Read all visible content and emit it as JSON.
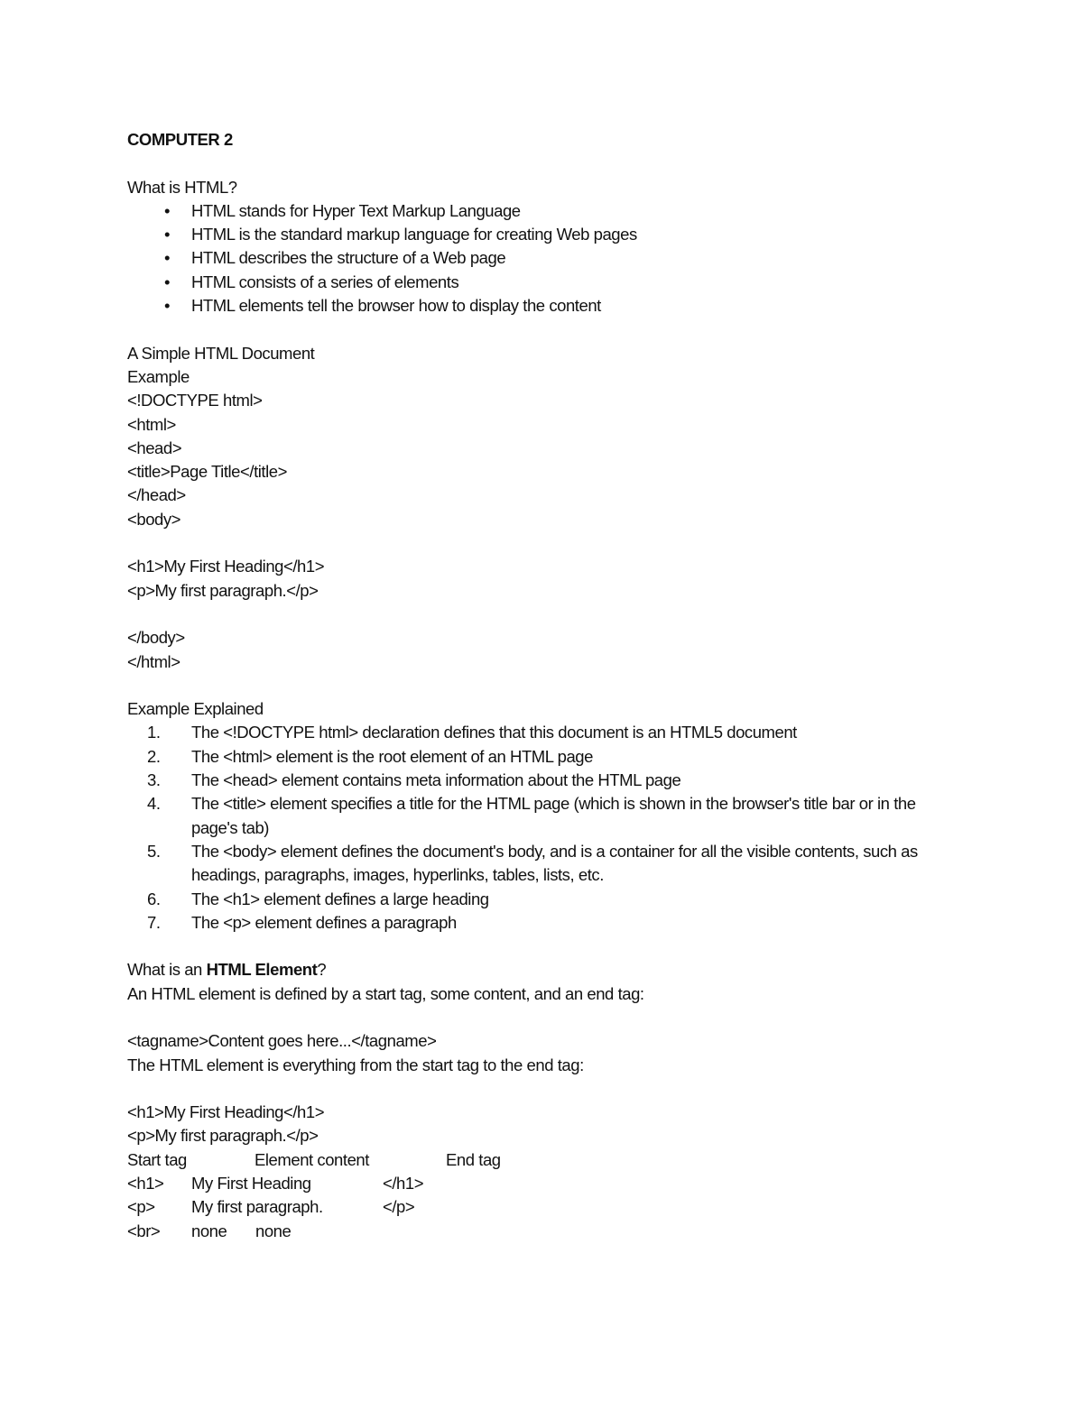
{
  "doc_title": "COMPUTER 2",
  "section1": {
    "heading": "What is HTML?",
    "bullets": [
      "HTML stands for Hyper Text Markup Language",
      "HTML is the standard markup language for creating Web pages",
      "HTML describes the structure of a Web page",
      "HTML consists of a series of elements",
      "HTML elements tell the browser how to display the content"
    ],
    "bullet_glyph": "•"
  },
  "section2": {
    "heading": "A Simple HTML Document",
    "subheading": "Example",
    "code_lines_a": [
      "<!DOCTYPE html>",
      "<html>",
      "<head>",
      "<title>Page Title</title>",
      "</head>",
      "<body>"
    ],
    "code_lines_b": [
      "<h1>My First Heading</h1>",
      "<p>My first paragraph.</p>"
    ],
    "code_lines_c": [
      "</body>",
      "</html>"
    ]
  },
  "section3": {
    "heading": "Example Explained",
    "items": [
      {
        "num": "1.",
        "text": "The <!DOCTYPE html> declaration defines that this document is an HTML5 document"
      },
      {
        "num": "2.",
        "text": "The <html> element is the root element of an HTML page"
      },
      {
        "num": "3.",
        "text": "The <head> element contains meta information about the HTML page"
      },
      {
        "num": "4.",
        "text": "The <title> element specifies a title for the HTML page (which is shown in the browser's title bar or in the page's tab)"
      },
      {
        "num": "5.",
        "text": "The <body> element defines the document's body, and is a container for all the visible contents, such as headings, paragraphs, images, hyperlinks, tables, lists, etc."
      },
      {
        "num": "6.",
        "text": "The <h1> element defines a large heading"
      },
      {
        "num": "7.",
        "text": "The <p> element defines a paragraph"
      }
    ]
  },
  "section4": {
    "heading_prefix": "What is an ",
    "heading_bold": "HTML Element",
    "heading_suffix": "?",
    "definition": "An HTML element is defined by a start tag, some content, and an end tag:",
    "syntax": "<tagname>Content goes here...</tagname>",
    "explanation": "The HTML element is everything from the start tag to the end tag:",
    "examples": [
      "<h1>My First Heading</h1>",
      "<p>My first paragraph.</p>"
    ],
    "table": {
      "headers": [
        "Start tag",
        "Element content",
        "End tag"
      ],
      "rows": [
        [
          "<h1>",
          "My First Heading",
          "</h1>"
        ],
        [
          "<p>",
          "My first paragraph.",
          "</p>"
        ],
        [
          "<br>",
          "none",
          "none"
        ]
      ]
    }
  }
}
